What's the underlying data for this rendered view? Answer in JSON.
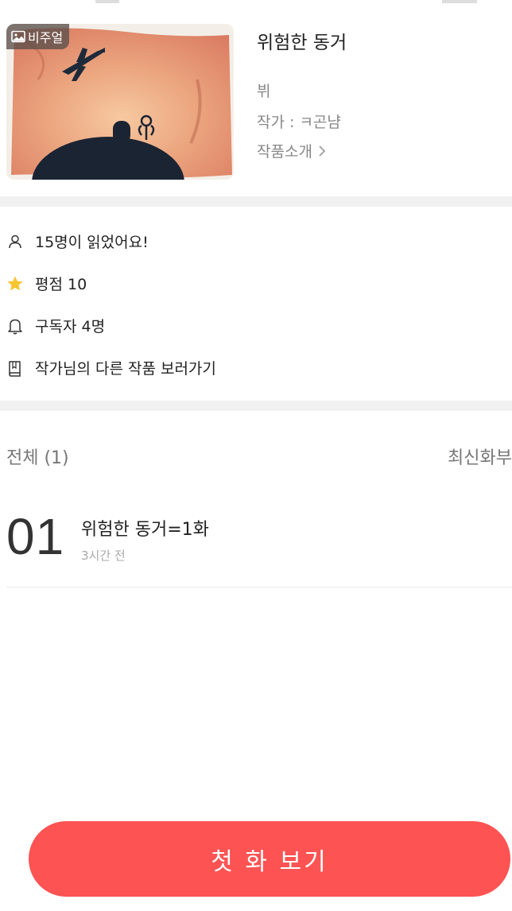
{
  "work": {
    "badge_label": "비주얼",
    "title": "위험한 동거",
    "genre": "뷔",
    "author": "작가 : ㅋ곤냠",
    "intro_link": "작품소개"
  },
  "stats": {
    "readers": "15명이 읽었어요!",
    "rating": "평점 10",
    "subscribers": "구독자 4명",
    "other_works": "작가님의 다른 작품 보러가기"
  },
  "episodes_header": {
    "total": "전체 (1)",
    "sort": "최신화부"
  },
  "episodes": [
    {
      "number": "01",
      "title": "위험한 동거=1화",
      "time": "3시간 전"
    }
  ],
  "cta": {
    "label": "첫 화 보기"
  },
  "colors": {
    "accent": "#fd5353",
    "star": "#f7c531",
    "divider": "#f1f1f1"
  },
  "icons": [
    "image-icon",
    "chevron-right-icon",
    "person-icon",
    "star-icon",
    "bell-icon",
    "book-icon"
  ]
}
